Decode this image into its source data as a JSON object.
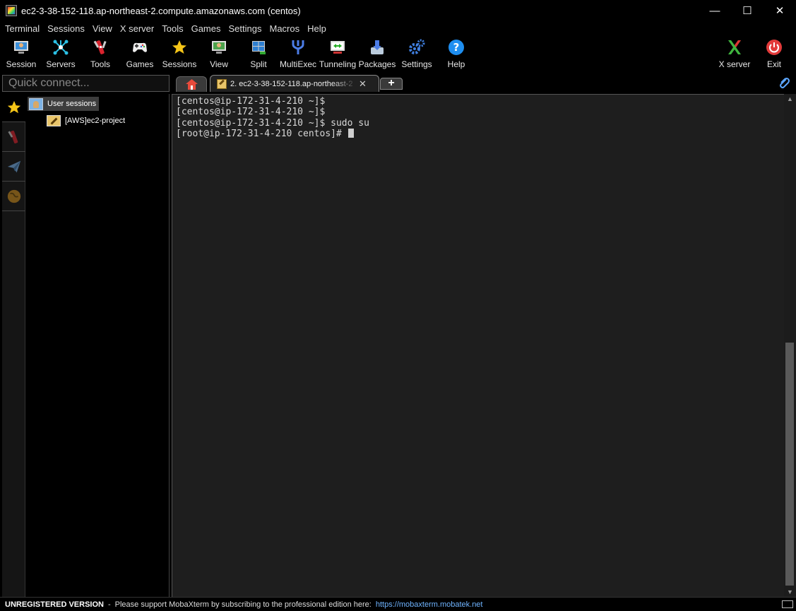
{
  "window": {
    "title": "ec2-3-38-152-118.ap-northeast-2.compute.amazonaws.com  (centos)",
    "minimize": "—",
    "maximize": "☐",
    "close": "✕"
  },
  "menu": [
    "Terminal",
    "Sessions",
    "View",
    "X server",
    "Tools",
    "Games",
    "Settings",
    "Macros",
    "Help"
  ],
  "toolbar": {
    "session": "Session",
    "servers": "Servers",
    "tools": "Tools",
    "games": "Games",
    "sessions": "Sessions",
    "view": "View",
    "split": "Split",
    "multiexec": "MultiExec",
    "tunneling": "Tunneling",
    "packages": "Packages",
    "settings": "Settings",
    "help": "Help",
    "xserver": "X server",
    "exit": "Exit"
  },
  "quick_connect": {
    "placeholder": "Quick connect..."
  },
  "tabs": {
    "session_label": "2. ec2-3-38-152-118.ap-northeast-2",
    "close": "✕",
    "new_tab": "+"
  },
  "sessions_tree": {
    "root": "User sessions",
    "items": [
      "[AWS]ec2-project"
    ]
  },
  "terminal": {
    "lines": [
      "[centos@ip-172-31-4-210 ~]$",
      "[centos@ip-172-31-4-210 ~]$",
      "[centos@ip-172-31-4-210 ~]$ sudo su",
      "[root@ip-172-31-4-210 centos]# "
    ]
  },
  "status": {
    "unregistered": "UNREGISTERED VERSION",
    "separator": "-",
    "message": "Please support MobaXterm by subscribing to the professional edition here:",
    "link": "https://mobaxterm.mobatek.net"
  },
  "colors": {
    "background": "#000000",
    "terminal_bg": "#1e1e1e",
    "accent": "#5ba5ff"
  }
}
